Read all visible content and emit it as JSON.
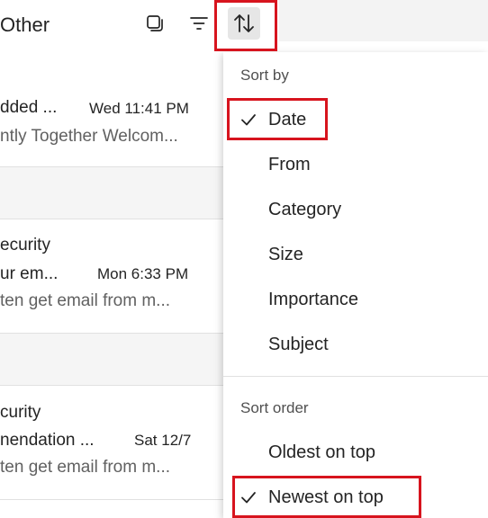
{
  "header": {
    "folder_title": "Other"
  },
  "toolbar": {
    "select_icon": "select-mode-icon",
    "filter_icon": "filter-icon",
    "sort_icon": "sort-arrows-icon"
  },
  "messages": [
    {
      "line1": "dded ...",
      "date": "Wed 11:41 PM",
      "line2": "ntly Together Welcom..."
    },
    {
      "line1": "ecurity",
      "line2": "ur em...",
      "date": "Mon 6:33 PM",
      "line3": "ten get email from m..."
    },
    {
      "line1": "curity",
      "line2": "nendation ...",
      "date": "Sat 12/7",
      "line3": "ten get email from m..."
    }
  ],
  "sort_menu": {
    "sort_by_header": "Sort by",
    "sort_by_options": [
      {
        "label": "Date",
        "checked": true
      },
      {
        "label": "From",
        "checked": false
      },
      {
        "label": "Category",
        "checked": false
      },
      {
        "label": "Size",
        "checked": false
      },
      {
        "label": "Importance",
        "checked": false
      },
      {
        "label": "Subject",
        "checked": false
      }
    ],
    "sort_order_header": "Sort order",
    "sort_order_options": [
      {
        "label": "Oldest on top",
        "checked": false
      },
      {
        "label": "Newest on top",
        "checked": true
      }
    ]
  },
  "colors": {
    "highlight": "#d7141e",
    "text": "#242424",
    "secondary_text": "#616161"
  }
}
